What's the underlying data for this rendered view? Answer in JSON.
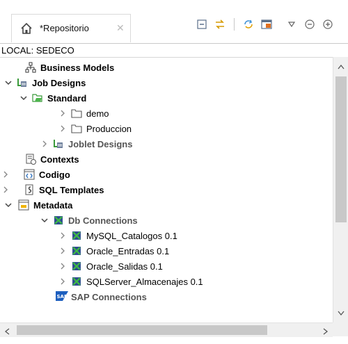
{
  "tab": {
    "title": "*Repositorio"
  },
  "location": "LOCAL: SEDECO",
  "toolbar": {
    "icons": [
      "collapse-icon",
      "sync-icon",
      "refresh-icon",
      "filter-icon",
      "view-menu-icon",
      "minimize-icon",
      "maximize-icon"
    ]
  },
  "tree": {
    "business_models": "Business Models",
    "job_designs": "Job Designs",
    "standard": "Standard",
    "demo": "demo",
    "produccion": "Produccion",
    "joblet_designs": "Joblet Designs",
    "contexts": "Contexts",
    "codigo": "Codigo",
    "sql_templates": "SQL Templates",
    "metadata": "Metadata",
    "db_connections": "Db Connections",
    "mysql": "MySQL_Catalogos 0.1",
    "oracle_entradas": "Oracle_Entradas 0.1",
    "oracle_salidas": "Oracle_Salidas 0.1",
    "sqlserver": "SQLServer_Almacenajes 0.1",
    "sap_connections": "SAP Connections"
  },
  "colors": {
    "folder_green": "#3a9a3a",
    "chevron": "#444444"
  }
}
